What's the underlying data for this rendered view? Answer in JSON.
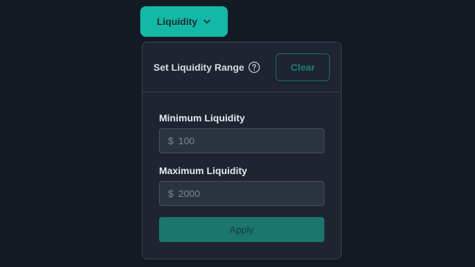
{
  "filter_button": {
    "label": "Liquidity",
    "icon": "chevron-down-icon"
  },
  "panel": {
    "title": "Set Liquidity Range",
    "help_icon": "question-circle-icon",
    "clear_label": "Clear",
    "min": {
      "label": "Minimum Liquidity",
      "currency": "$",
      "placeholder": "100",
      "value": ""
    },
    "max": {
      "label": "Maximum Liquidity",
      "currency": "$",
      "placeholder": "2000",
      "value": ""
    },
    "apply_label": "Apply"
  },
  "colors": {
    "background": "#131a24",
    "accent": "#14b8a6",
    "panel": "#1e2530",
    "apply": "#1b7670"
  }
}
